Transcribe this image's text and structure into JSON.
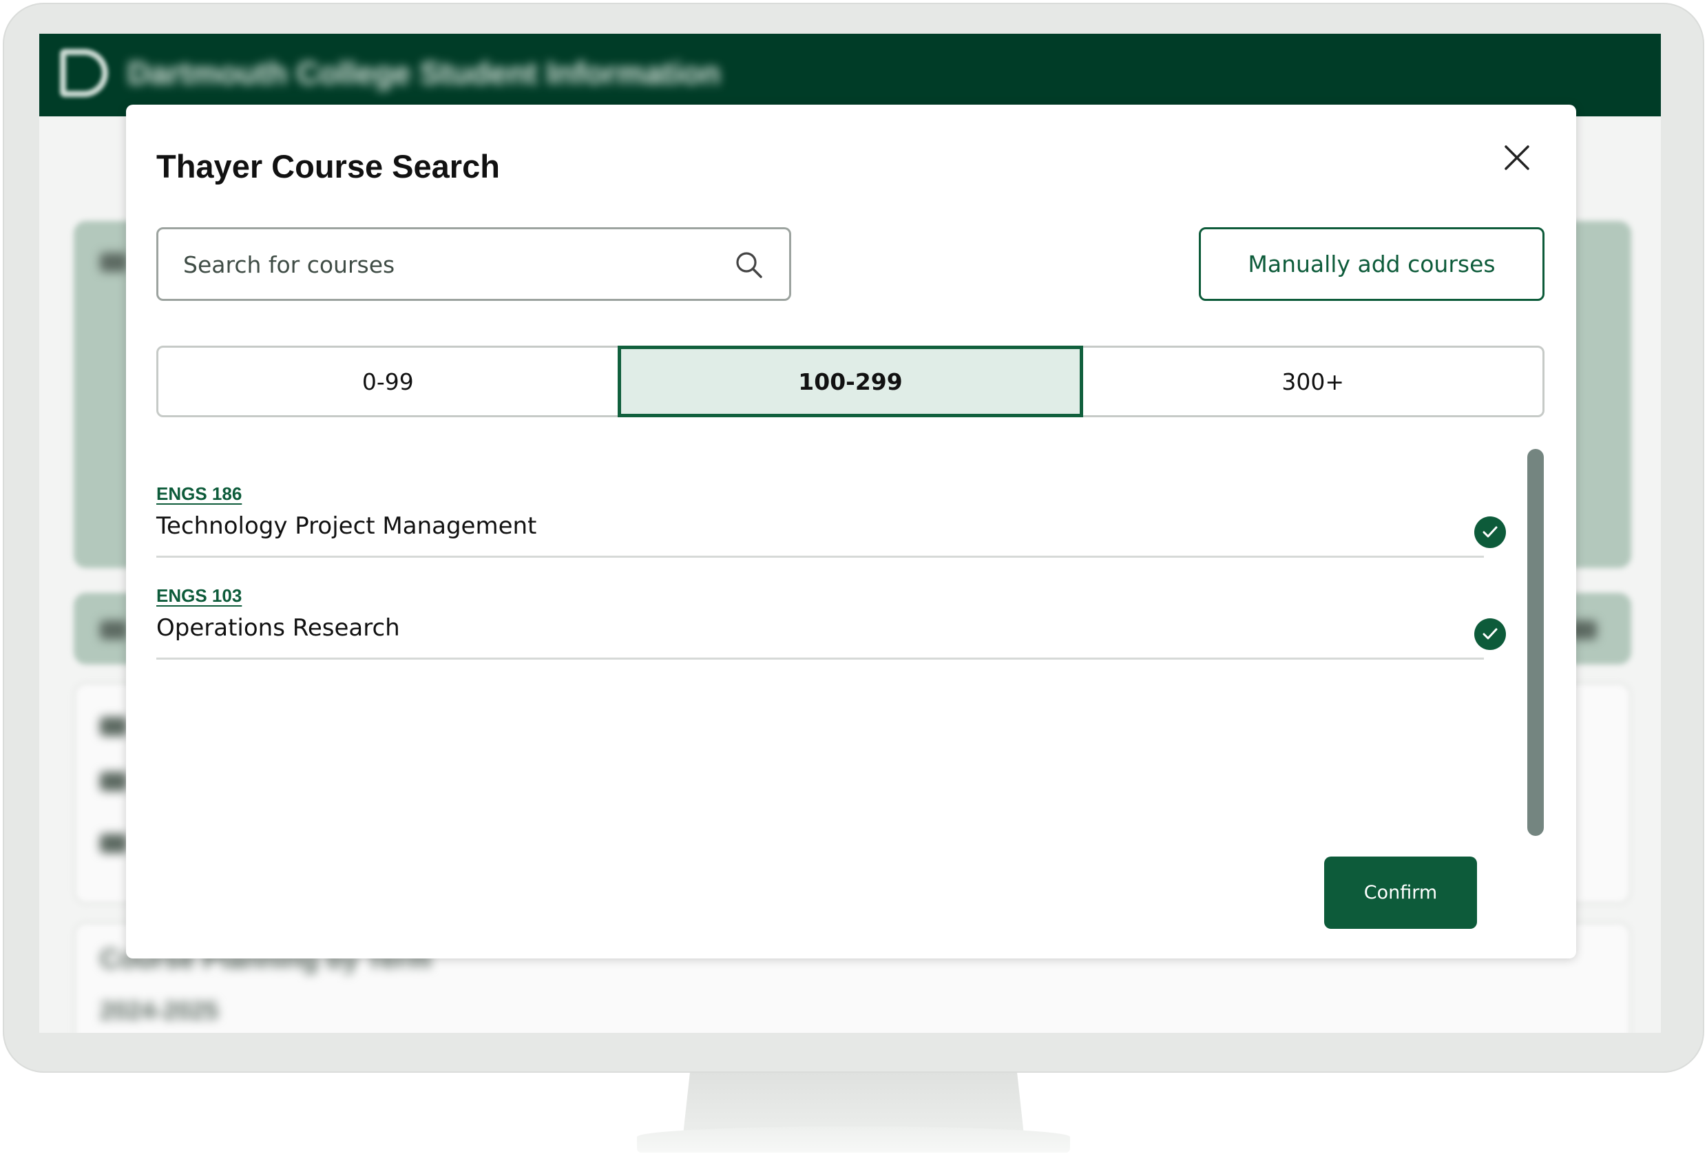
{
  "app": {
    "title": "Dartmouth College Student Information",
    "bg_heading": "Course Planning by Term",
    "bg_term": "2024-2025"
  },
  "modal": {
    "title": "Thayer Course Search",
    "search": {
      "placeholder": "Search for courses",
      "value": ""
    },
    "manual_add_label": "Manually add courses",
    "ranges": [
      {
        "label": "0-99",
        "active": false
      },
      {
        "label": "100-299",
        "active": true
      },
      {
        "label": "300+",
        "active": false
      }
    ],
    "courses": [
      {
        "code": "ENGS 186",
        "name": "Technology Project Management",
        "selected": true
      },
      {
        "code": "ENGS 103",
        "name": "Operations Research",
        "selected": true
      }
    ],
    "confirm_label": "Confirm"
  },
  "colors": {
    "brand_dark": "#003c27",
    "accent": "#0d5b3a",
    "active_tab_bg": "#e0ede7"
  },
  "icons": {
    "close": "close-icon",
    "search": "search-icon",
    "check": "check-circle-icon"
  }
}
